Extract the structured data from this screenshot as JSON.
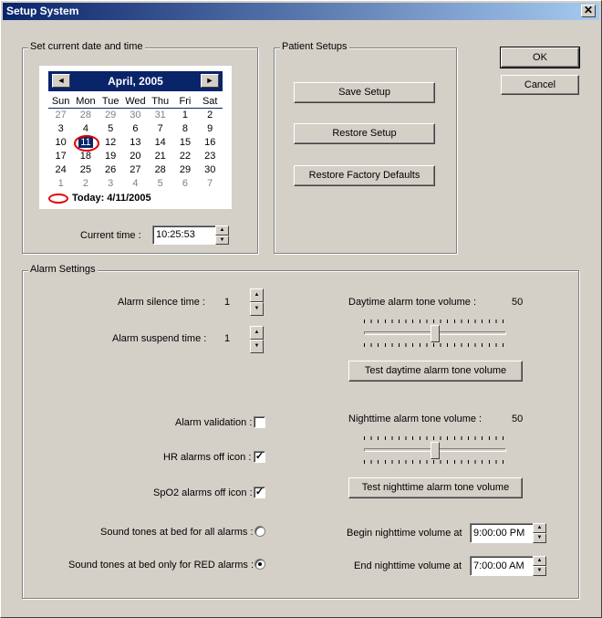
{
  "window": {
    "title": "Setup System",
    "close_glyph": "✕"
  },
  "date_group": {
    "label": "Set current date and time",
    "calendar": {
      "month_label": "April, 2005",
      "prev_glyph": "◄",
      "next_glyph": "►",
      "dow": [
        "Sun",
        "Mon",
        "Tue",
        "Wed",
        "Thu",
        "Fri",
        "Sat"
      ],
      "weeks": [
        [
          "27",
          "28",
          "29",
          "30",
          "31",
          "1",
          "2"
        ],
        [
          "3",
          "4",
          "5",
          "6",
          "7",
          "8",
          "9"
        ],
        [
          "10",
          "11",
          "12",
          "13",
          "14",
          "15",
          "16"
        ],
        [
          "17",
          "18",
          "19",
          "20",
          "21",
          "22",
          "23"
        ],
        [
          "24",
          "25",
          "26",
          "27",
          "28",
          "29",
          "30"
        ],
        [
          "1",
          "2",
          "3",
          "4",
          "5",
          "6",
          "7"
        ]
      ],
      "today_text": "Today: 4/11/2005"
    },
    "current_time_label": "Current time :",
    "current_time_value": "10:25:53"
  },
  "patient_group": {
    "label": "Patient Setups",
    "save": "Save Setup",
    "restore": "Restore Setup",
    "factory": "Restore Factory Defaults"
  },
  "dialog_buttons": {
    "ok": "OK",
    "cancel": "Cancel"
  },
  "alarm_group": {
    "label": "Alarm Settings",
    "silence_label": "Alarm silence time :",
    "silence_value": "1",
    "suspend_label": "Alarm suspend time :",
    "suspend_value": "1",
    "validation_label": "Alarm validation :",
    "validation_checked": false,
    "hr_label": "HR alarms off icon :",
    "hr_checked": true,
    "spo2_label": "SpO2 alarms off icon :",
    "spo2_checked": true,
    "sound_all_label": "Sound tones at bed for all alarms :",
    "sound_red_label": "Sound tones at bed only for RED alarms :",
    "sound_mode": "red",
    "day_volume_label": "Daytime alarm tone volume :",
    "day_volume_value": "50",
    "day_volume_level": 0.5,
    "test_day": "Test daytime alarm tone volume",
    "night_volume_label": "Nighttime alarm tone volume :",
    "night_volume_value": "50",
    "night_volume_level": 0.5,
    "test_night": "Test nighttime alarm tone volume",
    "begin_label": "Begin nighttime volume at",
    "begin_value": "9:00:00 PM",
    "end_label": "End nighttime volume at",
    "end_value": "7:00:00 AM"
  },
  "glyphs": {
    "up": "▲",
    "down": "▼",
    "check": "✓"
  }
}
